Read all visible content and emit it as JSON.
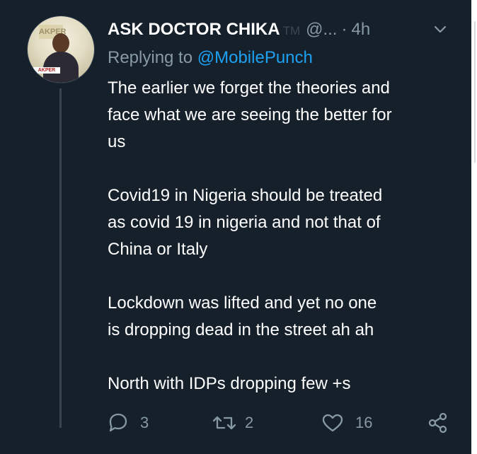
{
  "tweet": {
    "author_name": "ASK DOCTOR CHIKA",
    "author_mark": "TM",
    "handle": "@...",
    "separator": "·",
    "time": "4h",
    "reply_prefix": "Replying to",
    "reply_mention": "@MobilePunch",
    "paragraphs": [
      "The earlier we forget the theories and\nface what we are seeing the better for\nus",
      "Covid19 in Nigeria should be treated\nas covid 19 in nigeria and not that of\nChina or Italy",
      "Lockdown was lifted and yet no one\nis dropping dead in the street ah ah",
      "North with IDPs dropping few +s"
    ],
    "actions": {
      "replies": "3",
      "retweets": "2",
      "likes": "16"
    },
    "avatar": {
      "sign_text": "AKPER",
      "banner_text": "AKPER"
    }
  },
  "theme": {
    "background": "#15202b",
    "text": "#ffffff",
    "muted": "#8899a6",
    "link": "#1da1f2",
    "thread_line": "#37444d"
  },
  "icons": {
    "reply": "speech-bubble-icon",
    "retweet": "retweet-icon",
    "like": "heart-icon",
    "share": "share-icon",
    "menu": "chevron-down-icon"
  }
}
